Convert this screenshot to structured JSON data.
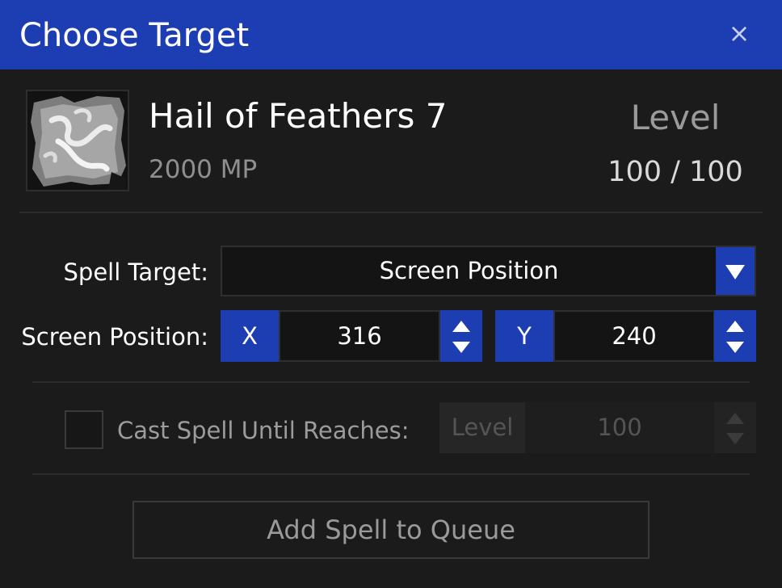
{
  "window": {
    "title": "Choose Target",
    "close_glyph": "×"
  },
  "spell": {
    "name": "Hail of Feathers 7",
    "cost": "2000 MP",
    "level_label": "Level",
    "level_value": "100 / 100",
    "icon": "feather-swirl-icon"
  },
  "target": {
    "label": "Spell Target:",
    "selected": "Screen Position"
  },
  "position": {
    "label": "Screen Position:",
    "x_label": "X",
    "x_value": "316",
    "y_label": "Y",
    "y_value": "240"
  },
  "cast_until": {
    "label": "Cast Spell Until Reaches:",
    "checked": false,
    "unit_label": "Level",
    "value": "100"
  },
  "queue_button": {
    "label": "Add Spell to Queue"
  },
  "colors": {
    "accent": "#1d3db3",
    "background": "#1b1b1b",
    "field_background": "#141414"
  }
}
